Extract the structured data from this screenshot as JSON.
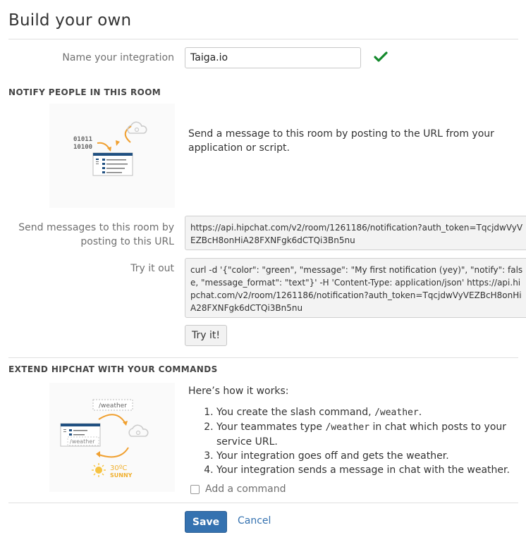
{
  "page": {
    "title": "Build your own"
  },
  "integration": {
    "name_label": "Name your integration",
    "name_value": "Taiga.io",
    "valid_icon": "check-icon"
  },
  "notify": {
    "heading": "NOTIFY PEOPLE IN THIS ROOM",
    "illustration": {
      "binary_line1": "01011",
      "binary_line2": "10100"
    },
    "description": "Send a message to this room by posting to the URL from your application or script.",
    "url_label": "Send messages to this room by posting to this URL",
    "url_value": "https://api.hipchat.com/v2/room/1261186/notification?auth_token=TqcjdwVyVEZBcH8onHiA28FXNFgk6dCTQi3Bn5nu",
    "try_label": "Try it out",
    "curl_value": "curl -d '{\"color\": \"green\", \"message\": \"My first notification (yey)\", \"notify\": false, \"message_format\": \"text\"}' -H 'Content-Type: application/json' https://api.hipchat.com/v2/room/1261186/notification?auth_token=TqcjdwVyVEZBcH8onHiA28FXNFgk6dCTQi3Bn5nu",
    "try_button": "Try it!"
  },
  "commands": {
    "heading": "EXTEND HIPCHAT WITH YOUR COMMANDS",
    "illustration": {
      "tag_top": "/weather",
      "tag_window": "/weather",
      "temperature": "30ºC",
      "condition": "SUNNY"
    },
    "how_title": "Here’s how it works:",
    "steps": [
      {
        "before": "You create the slash command, ",
        "code": "/weather",
        "after": "."
      },
      {
        "before": "Your teammates type ",
        "code": "/weather",
        "after": " in chat which posts to your service URL."
      },
      {
        "text": "Your integration goes off and gets the weather."
      },
      {
        "text": "Your integration sends a message in chat with the weather."
      }
    ],
    "add_command_label": "Add a command"
  },
  "footer": {
    "save": "Save",
    "cancel": "Cancel"
  },
  "colors": {
    "accent": "#3572b0",
    "success": "#14892c",
    "orange": "#f0a030"
  }
}
